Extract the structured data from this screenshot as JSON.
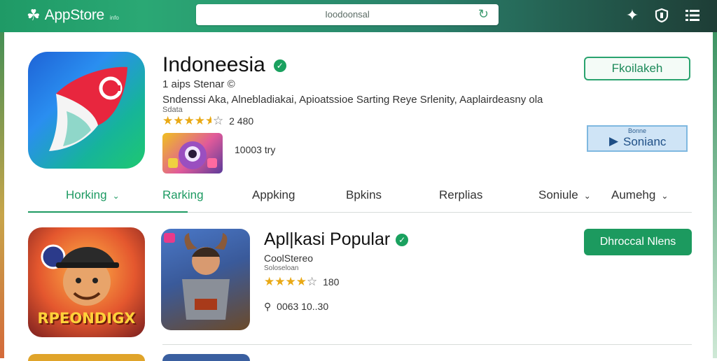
{
  "topbar": {
    "brand": "AppStore",
    "brand_sub": "info",
    "search_value": "Ioodoonsal",
    "icons": [
      "store-icon",
      "refresh-icon",
      "star-badge-icon",
      "shield-icon",
      "menu-icon"
    ]
  },
  "header_app": {
    "title": "Indoneesia",
    "developer": "1 aips Stenar",
    "developer_mark": "©",
    "description": "Sndenssi Aka, Alnebladiakai, Apioatssioe Sarting Reye Srlenity, Aaplairdeasny ola",
    "category": "Sdata",
    "rating_text": "2 480",
    "stars_filled": 4.5,
    "downloads": "10003 try",
    "install_button": "Fkoilakeh",
    "preview_button_top": "Bonne",
    "preview_button": "Sonianc"
  },
  "tabs": [
    {
      "label": "Horking",
      "chevron": true,
      "active": true
    },
    {
      "label": "Rarking",
      "chevron": false,
      "active": true
    },
    {
      "label": "Appking",
      "chevron": false,
      "active": false
    },
    {
      "label": "Bpkins",
      "chevron": false,
      "active": false
    },
    {
      "label": "Rerplias",
      "chevron": false,
      "active": false
    },
    {
      "label": "Soniule",
      "chevron": true,
      "active": false
    },
    {
      "label": "Aumehg",
      "chevron": true,
      "active": false
    }
  ],
  "list_item": {
    "title": "Apl|kasi Popular",
    "developer": "CoolStereo",
    "category": "Soloseloan",
    "rating_text": "180",
    "stars_filled": 4,
    "downloads": "0063 10..30",
    "action_button": "Dhroccal Nlens",
    "thumbnail_text": "RPEONDIGX"
  },
  "colors": {
    "accent": "#1d9a62",
    "topbar": "#2a7f6a",
    "star": "#e9a915"
  }
}
